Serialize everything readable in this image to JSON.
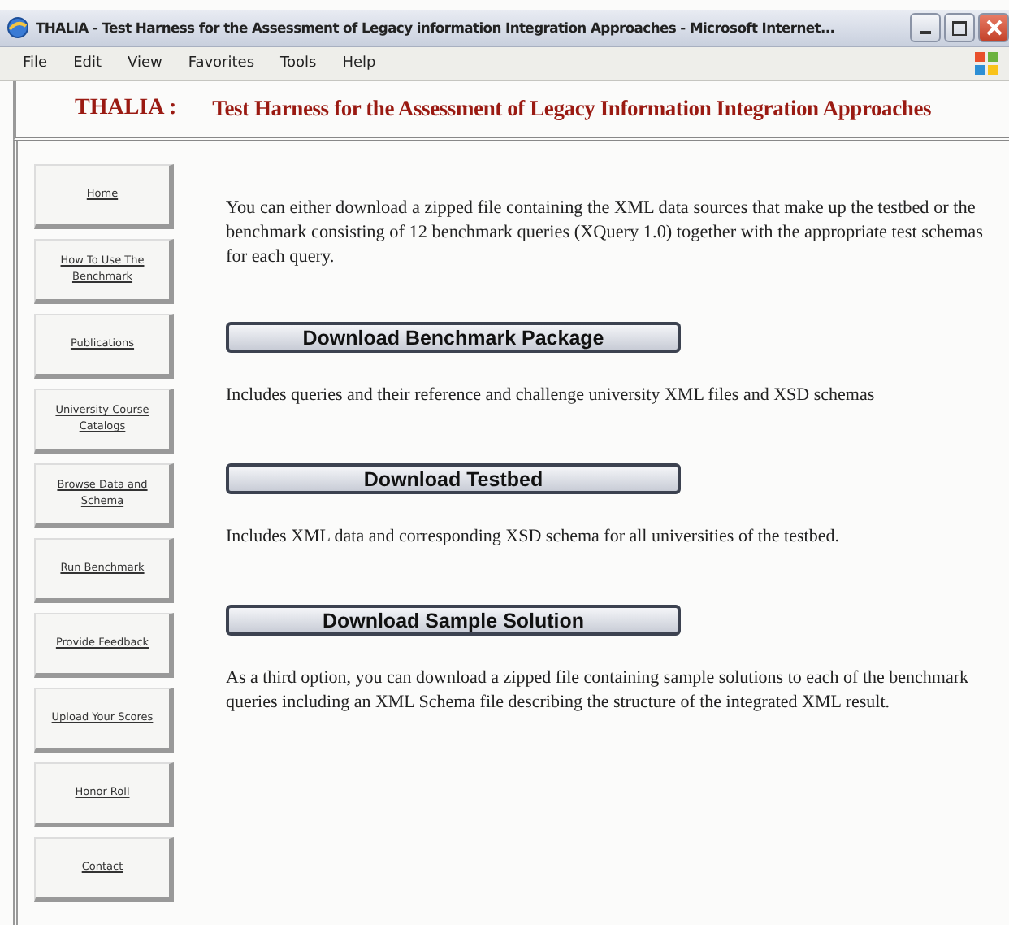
{
  "window": {
    "title": "THALIA - Test Harness for the Assessment of Legacy information Integration Approaches - Microsoft Internet..."
  },
  "menu": [
    "File",
    "Edit",
    "View",
    "Favorites",
    "Tools",
    "Help"
  ],
  "header": {
    "brand": "THALIA :",
    "title": "Test Harness for the Assessment of Legacy Information Integration Approaches"
  },
  "sidebar": {
    "items": [
      "Home",
      "How To Use The Benchmark",
      "Publications",
      "University Course Catalogs",
      "Browse Data and Schema",
      "Run Benchmark",
      "Provide Feedback",
      "Upload Your Scores",
      "Honor Roll",
      "Contact"
    ]
  },
  "intro": "You can either download a zipped file containing the XML data sources that make up the testbed or the benchmark consisting of 12 benchmark queries (XQuery 1.0) together with the appropriate test schemas for each query.",
  "downloads": [
    {
      "button": "Download Benchmark Package",
      "description": "Includes queries and their reference and challenge university XML files and XSD schemas"
    },
    {
      "button": "Download Testbed",
      "description": "Includes XML data and corresponding XSD schema for all universities of the testbed."
    },
    {
      "button": "Download Sample Solution",
      "description": "As a third option, you can download a zipped file containing sample solutions to each of the benchmark queries including an XML Schema file describing the structure of the integrated XML result."
    }
  ]
}
